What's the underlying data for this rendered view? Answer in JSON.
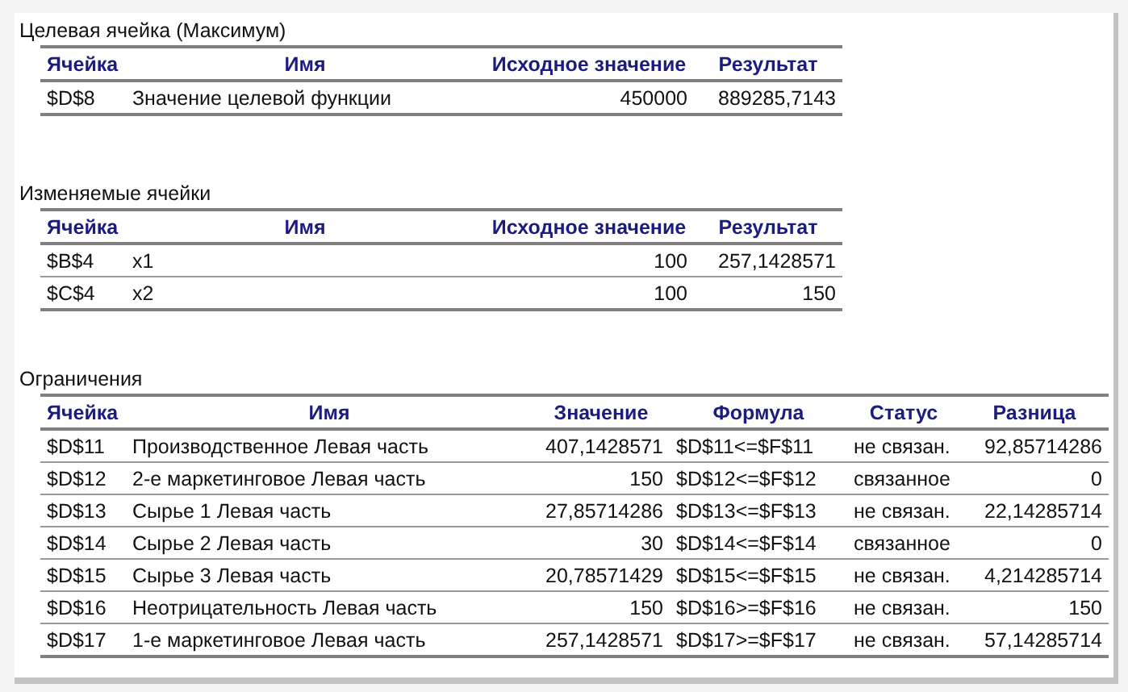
{
  "sections": [
    {
      "title": "Целевая ячейка (Максимум)",
      "columns": [
        {
          "label": "Ячейка",
          "kind": "text"
        },
        {
          "label": "Имя",
          "kind": "text"
        },
        {
          "label": "Исходное значение",
          "kind": "number"
        },
        {
          "label": "Результат",
          "kind": "number"
        }
      ],
      "rows": [
        [
          "$D$8",
          "Значение целевой функции",
          "450000",
          "889285,7143"
        ]
      ]
    },
    {
      "title": "Изменяемые ячейки",
      "columns": [
        {
          "label": "Ячейка",
          "kind": "text"
        },
        {
          "label": "Имя",
          "kind": "text"
        },
        {
          "label": "Исходное значение",
          "kind": "number"
        },
        {
          "label": "Результат",
          "kind": "number"
        }
      ],
      "rows": [
        [
          "$B$4",
          "x1",
          "100",
          "257,1428571"
        ],
        [
          "$C$4",
          "x2",
          "100",
          "150"
        ]
      ]
    },
    {
      "title": "Ограничения",
      "columns": [
        {
          "label": "Ячейка",
          "kind": "text"
        },
        {
          "label": "Имя",
          "kind": "text"
        },
        {
          "label": "Значение",
          "kind": "number"
        },
        {
          "label": "Формула",
          "kind": "text"
        },
        {
          "label": "Статус",
          "kind": "text"
        },
        {
          "label": "Разница",
          "kind": "number"
        }
      ],
      "rows": [
        [
          "$D$11",
          "Производственное Левая часть",
          "407,1428571",
          "$D$11<=$F$11",
          "не связан.",
          "92,85714286"
        ],
        [
          "$D$12",
          "2-е маркетинговое Левая часть",
          "150",
          "$D$12<=$F$12",
          "связанное",
          "0"
        ],
        [
          "$D$13",
          "Сырье 1 Левая часть",
          "27,85714286",
          "$D$13<=$F$13",
          "не связан.",
          "22,14285714"
        ],
        [
          "$D$14",
          "Сырье 2 Левая часть",
          "30",
          "$D$14<=$F$14",
          "связанное",
          "0"
        ],
        [
          "$D$15",
          "Сырье 3 Левая часть",
          "20,78571429",
          "$D$15<=$F$15",
          "не связан.",
          "4,214285714"
        ],
        [
          "$D$16",
          "Неотрицательность Левая часть",
          "150",
          "$D$16>=$F$16",
          "не связан.",
          "150"
        ],
        [
          "$D$17",
          "1-е маркетинговое Левая часть",
          "257,1428571",
          "$D$17>=$F$17",
          "не связан.",
          "57,14285714"
        ]
      ]
    }
  ]
}
